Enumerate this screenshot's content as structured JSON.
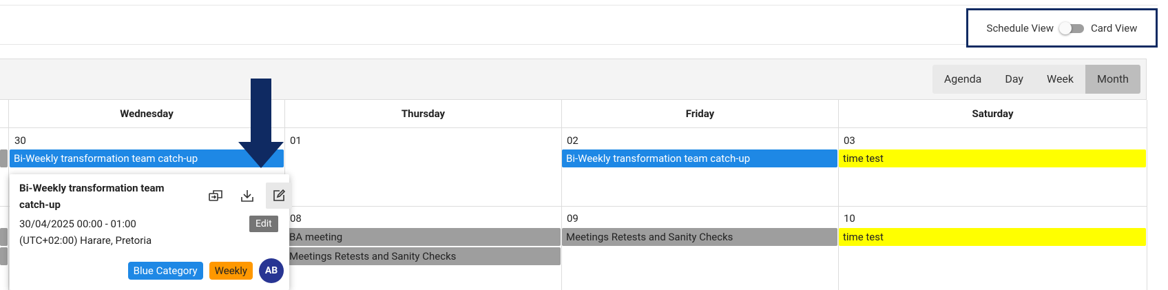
{
  "view_toggle": {
    "schedule_label": "Schedule View",
    "card_label": "Card View",
    "checked": false
  },
  "toolbar": {
    "views": [
      "Agenda",
      "Day",
      "Week",
      "Month"
    ],
    "active_view": "Month"
  },
  "calendar": {
    "day_headers": [
      "Wednesday",
      "Thursday",
      "Friday",
      "Saturday"
    ],
    "week1": {
      "dates": [
        "30",
        "01",
        "02",
        "03"
      ],
      "events": {
        "wednesday": "Bi-Weekly transformation team catch-up",
        "friday": "Bi-Weekly transformation team catch-up",
        "saturday": "time test"
      }
    },
    "week2": {
      "dates": [
        "08",
        "09",
        "10"
      ],
      "events": {
        "thursday_1": "BA meeting",
        "thursday_2": "Meetings Retests and Sanity Checks",
        "friday": "Meetings Retests and Sanity Checks",
        "saturday": "time test"
      }
    }
  },
  "popup": {
    "title": "Bi-Weekly transformation team catch-up",
    "time": "30/04/2025 00:00 - 01:00",
    "timezone": "(UTC+02:00) Harare, Pretoria",
    "tooltip": "Edit",
    "tags": [
      "Blue Category",
      "Weekly"
    ],
    "avatar_initials": "AB",
    "icons": [
      "move-to-icon",
      "download-icon",
      "edit-icon"
    ]
  },
  "colors": {
    "event_blue": "#1e88e5",
    "event_gray": "#9e9e9e",
    "event_yellow": "#ffff00",
    "tag_orange": "#ff9800",
    "avatar": "#283593",
    "highlight_border": "#0f2a62",
    "arrow": "#0f2a62"
  }
}
